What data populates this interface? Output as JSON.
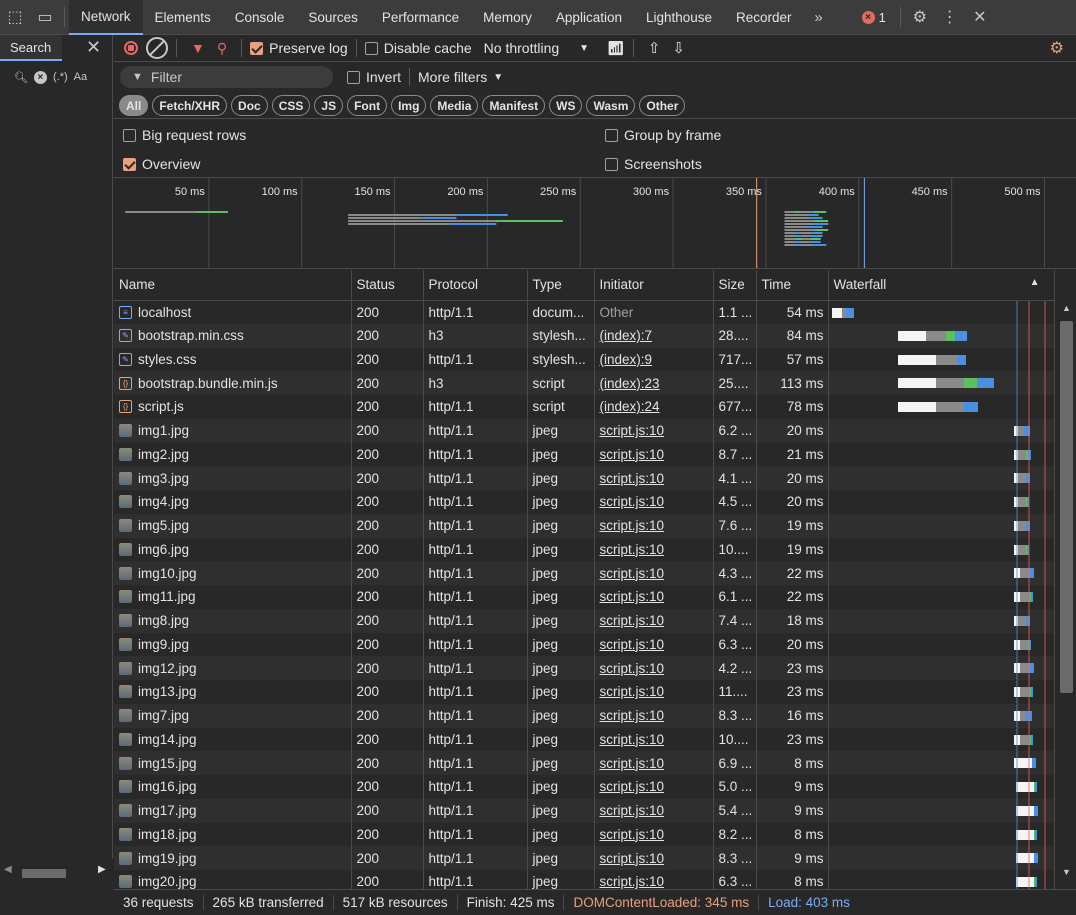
{
  "tabs": [
    "Network",
    "Elements",
    "Console",
    "Sources",
    "Performance",
    "Memory",
    "Application",
    "Lighthouse",
    "Recorder"
  ],
  "error_count": "1",
  "search_panel": {
    "title": "Search",
    "regex_label": "(.*)",
    "case_label": "Aa"
  },
  "toolbar": {
    "preserve_log": "Preserve log",
    "disable_cache": "Disable cache",
    "throttling": "No throttling"
  },
  "filter": {
    "placeholder": "Filter",
    "invert": "Invert",
    "more_filters": "More filters"
  },
  "type_filters": [
    "All",
    "Fetch/XHR",
    "Doc",
    "CSS",
    "JS",
    "Font",
    "Img",
    "Media",
    "Manifest",
    "WS",
    "Wasm",
    "Other"
  ],
  "options": {
    "big_request_rows": "Big request rows",
    "group_by_frame": "Group by frame",
    "overview": "Overview",
    "screenshots": "Screenshots"
  },
  "overview_ticks": [
    "50 ms",
    "100 ms",
    "150 ms",
    "200 ms",
    "250 ms",
    "300 ms",
    "350 ms",
    "400 ms",
    "450 ms",
    "500 ms"
  ],
  "columns": [
    "Name",
    "Status",
    "Protocol",
    "Type",
    "Initiator",
    "Size",
    "Time",
    "Waterfall"
  ],
  "rows": [
    {
      "name": "localhost",
      "icon": "doc",
      "status": "200",
      "protocol": "http/1.1",
      "type": "docum...",
      "initiator": "Other",
      "size": "1.1 ...",
      "time": "54 ms",
      "wf": [
        0,
        10,
        14,
        22
      ]
    },
    {
      "name": "bootstrap.min.css",
      "icon": "css",
      "status": "200",
      "protocol": "h3",
      "type": "stylesh...",
      "initiator": "(index):7",
      "size": "28....",
      "time": "84 ms",
      "wf": [
        66,
        94,
        114,
        136
      ]
    },
    {
      "name": "styles.css",
      "icon": "css",
      "status": "200",
      "protocol": "http/1.1",
      "type": "stylesh...",
      "initiator": "(index):9",
      "size": "717...",
      "time": "57 ms",
      "wf": [
        66,
        104,
        126,
        134
      ]
    },
    {
      "name": "bootstrap.bundle.min.js",
      "icon": "js",
      "status": "200",
      "protocol": "h3",
      "type": "script",
      "initiator": "(index):23",
      "size": "25....",
      "time": "113 ms",
      "wf": [
        66,
        104,
        132,
        162
      ]
    },
    {
      "name": "script.js",
      "icon": "js",
      "status": "200",
      "protocol": "http/1.1",
      "type": "script",
      "initiator": "(index):24",
      "size": "677...",
      "time": "78 ms",
      "wf": [
        66,
        104,
        132,
        146
      ]
    },
    {
      "name": "img1.jpg",
      "icon": "img",
      "status": "200",
      "protocol": "http/1.1",
      "type": "jpeg",
      "initiator": "script.js:10",
      "size": "6.2 ...",
      "time": "20 ms",
      "wf": [
        182,
        186,
        192,
        198
      ]
    },
    {
      "name": "img2.jpg",
      "icon": "img",
      "status": "200",
      "protocol": "http/1.1",
      "type": "jpeg",
      "initiator": "script.js:10",
      "size": "8.7 ...",
      "time": "21 ms",
      "wf": [
        182,
        186,
        194,
        200
      ]
    },
    {
      "name": "img3.jpg",
      "icon": "img",
      "status": "200",
      "protocol": "http/1.1",
      "type": "jpeg",
      "initiator": "script.js:10",
      "size": "4.1 ...",
      "time": "20 ms",
      "wf": [
        182,
        186,
        194,
        198
      ]
    },
    {
      "name": "img4.jpg",
      "icon": "img",
      "status": "200",
      "protocol": "http/1.1",
      "type": "jpeg",
      "initiator": "script.js:10",
      "size": "4.5 ...",
      "time": "20 ms",
      "wf": [
        182,
        186,
        194,
        198
      ]
    },
    {
      "name": "img5.jpg",
      "icon": "img",
      "status": "200",
      "protocol": "http/1.1",
      "type": "jpeg",
      "initiator": "script.js:10",
      "size": "7.6 ...",
      "time": "19 ms",
      "wf": [
        182,
        186,
        194,
        198
      ]
    },
    {
      "name": "img6.jpg",
      "icon": "img",
      "status": "200",
      "protocol": "http/1.1",
      "type": "jpeg",
      "initiator": "script.js:10",
      "size": "10....",
      "time": "19 ms",
      "wf": [
        182,
        186,
        194,
        198
      ]
    },
    {
      "name": "img10.jpg",
      "icon": "img",
      "status": "200",
      "protocol": "http/1.1",
      "type": "jpeg",
      "initiator": "script.js:10",
      "size": "4.3 ...",
      "time": "22 ms",
      "wf": [
        182,
        188,
        198,
        202
      ]
    },
    {
      "name": "img11.jpg",
      "icon": "img",
      "status": "200",
      "protocol": "http/1.1",
      "type": "jpeg",
      "initiator": "script.js:10",
      "size": "6.1 ...",
      "time": "22 ms",
      "wf": [
        182,
        188,
        198,
        202
      ]
    },
    {
      "name": "img8.jpg",
      "icon": "img",
      "status": "200",
      "protocol": "http/1.1",
      "type": "jpeg",
      "initiator": "script.js:10",
      "size": "7.4 ...",
      "time": "18 ms",
      "wf": [
        182,
        186,
        194,
        198
      ]
    },
    {
      "name": "img9.jpg",
      "icon": "img",
      "status": "200",
      "protocol": "http/1.1",
      "type": "jpeg",
      "initiator": "script.js:10",
      "size": "6.3 ...",
      "time": "20 ms",
      "wf": [
        182,
        188,
        196,
        200
      ]
    },
    {
      "name": "img12.jpg",
      "icon": "img",
      "status": "200",
      "protocol": "http/1.1",
      "type": "jpeg",
      "initiator": "script.js:10",
      "size": "4.2 ...",
      "time": "23 ms",
      "wf": [
        182,
        188,
        198,
        202
      ]
    },
    {
      "name": "img13.jpg",
      "icon": "img",
      "status": "200",
      "protocol": "http/1.1",
      "type": "jpeg",
      "initiator": "script.js:10",
      "size": "11....",
      "time": "23 ms",
      "wf": [
        182,
        188,
        198,
        202
      ]
    },
    {
      "name": "img7.jpg",
      "icon": "img",
      "status": "200",
      "protocol": "http/1.1",
      "type": "jpeg",
      "initiator": "script.js:10",
      "size": "8.3 ...",
      "time": "16 ms",
      "wf": [
        182,
        188,
        194,
        200
      ]
    },
    {
      "name": "img14.jpg",
      "icon": "img",
      "status": "200",
      "protocol": "http/1.1",
      "type": "jpeg",
      "initiator": "script.js:10",
      "size": "10....",
      "time": "23 ms",
      "wf": [
        182,
        188,
        198,
        202
      ]
    },
    {
      "name": "img15.jpg",
      "icon": "img",
      "status": "200",
      "protocol": "http/1.1",
      "type": "jpeg",
      "initiator": "script.js:10",
      "size": "6.9 ...",
      "time": "8 ms",
      "wf": [
        182,
        200,
        200,
        204
      ]
    },
    {
      "name": "img16.jpg",
      "icon": "img",
      "status": "200",
      "protocol": "http/1.1",
      "type": "jpeg",
      "initiator": "script.js:10",
      "size": "5.0 ...",
      "time": "9 ms",
      "wf": [
        184,
        202,
        202,
        206
      ]
    },
    {
      "name": "img17.jpg",
      "icon": "img",
      "status": "200",
      "protocol": "http/1.1",
      "type": "jpeg",
      "initiator": "script.js:10",
      "size": "5.4 ...",
      "time": "9 ms",
      "wf": [
        184,
        202,
        202,
        206
      ]
    },
    {
      "name": "img18.jpg",
      "icon": "img",
      "status": "200",
      "protocol": "http/1.1",
      "type": "jpeg",
      "initiator": "script.js:10",
      "size": "8.2 ...",
      "time": "8 ms",
      "wf": [
        184,
        202,
        202,
        206
      ]
    },
    {
      "name": "img19.jpg",
      "icon": "img",
      "status": "200",
      "protocol": "http/1.1",
      "type": "jpeg",
      "initiator": "script.js:10",
      "size": "8.3 ...",
      "time": "9 ms",
      "wf": [
        184,
        202,
        202,
        206
      ]
    },
    {
      "name": "img20.jpg",
      "icon": "img",
      "status": "200",
      "protocol": "http/1.1",
      "type": "jpeg",
      "initiator": "script.js:10",
      "size": "6.3 ...",
      "time": "8 ms",
      "wf": [
        184,
        202,
        202,
        206
      ]
    }
  ],
  "status_bar": {
    "requests": "36 requests",
    "transferred": "265 kB transferred",
    "resources": "517 kB resources",
    "finish": "Finish: 425 ms",
    "dom": "DOMContentLoaded: 345 ms",
    "load": "Load: 403 ms"
  },
  "colors": {
    "accent": "#7cacf8",
    "dom": "#e8a07e",
    "load": "#7cacf8",
    "error": "#e46962"
  }
}
